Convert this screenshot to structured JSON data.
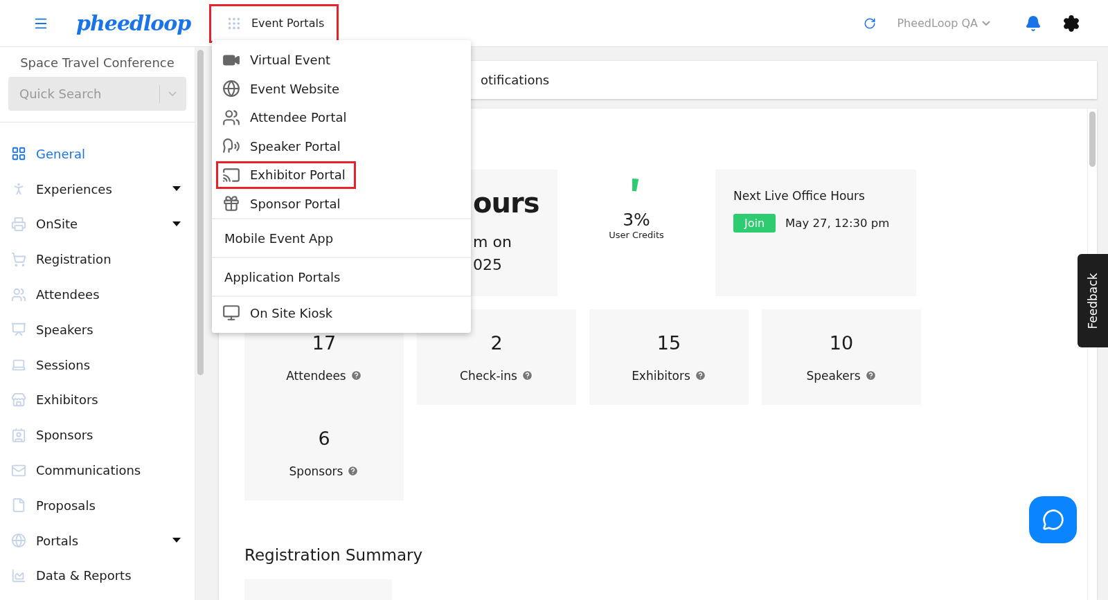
{
  "topbar": {
    "logo": "pheedloop",
    "event_portals": {
      "label": "Event Portals",
      "highlighted": true
    },
    "account": "PheedLoop QA"
  },
  "sidebar": {
    "event_title": "Space Travel Conference",
    "search": {
      "placeholder": "Quick Search"
    },
    "items": [
      {
        "label": "General",
        "selected": true,
        "expandable": false
      },
      {
        "label": "Experiences",
        "selected": false,
        "expandable": true
      },
      {
        "label": "OnSite",
        "selected": false,
        "expandable": true
      },
      {
        "label": "Registration",
        "selected": false,
        "expandable": false
      },
      {
        "label": "Attendees",
        "selected": false,
        "expandable": false
      },
      {
        "label": "Speakers",
        "selected": false,
        "expandable": false
      },
      {
        "label": "Sessions",
        "selected": false,
        "expandable": false
      },
      {
        "label": "Exhibitors",
        "selected": false,
        "expandable": false
      },
      {
        "label": "Sponsors",
        "selected": false,
        "expandable": false
      },
      {
        "label": "Communications",
        "selected": false,
        "expandable": false
      },
      {
        "label": "Proposals",
        "selected": false,
        "expandable": false
      },
      {
        "label": "Portals",
        "selected": false,
        "expandable": true
      },
      {
        "label": "Data & Reports",
        "selected": false,
        "expandable": false
      }
    ]
  },
  "dropdown": {
    "items": [
      {
        "kind": "icon",
        "label": "Virtual Event",
        "highlighted": false
      },
      {
        "kind": "icon",
        "label": "Event Website",
        "highlighted": false
      },
      {
        "kind": "icon",
        "label": "Attendee Portal",
        "highlighted": false
      },
      {
        "kind": "icon",
        "label": "Speaker Portal",
        "highlighted": false
      },
      {
        "kind": "icon",
        "label": "Exhibitor Portal",
        "highlighted": true
      },
      {
        "kind": "icon",
        "label": "Sponsor Portal",
        "highlighted": false
      },
      {
        "kind": "plain",
        "label": "Mobile Event App",
        "highlighted": false
      },
      {
        "kind": "plain",
        "label": "Application Portals",
        "highlighted": false
      },
      {
        "kind": "icon",
        "label": "On Site Kiosk",
        "highlighted": false
      }
    ]
  },
  "tab_fragment": "otifications",
  "hours_card": {
    "big": "ours",
    "line_1": "m on",
    "line_2": "025"
  },
  "credits": {
    "level": 0.03,
    "value": "3%",
    "label": "User Credits"
  },
  "office_hours": {
    "title": "Next Live Office Hours",
    "join": "Join",
    "time": "May 27, 12:30 pm"
  },
  "stats": [
    {
      "value": "17",
      "label": "Attendees"
    },
    {
      "value": "2",
      "label": "Check-ins"
    },
    {
      "value": "15",
      "label": "Exhibitors"
    },
    {
      "value": "10",
      "label": "Speakers"
    },
    {
      "value": "6",
      "label": "Sponsors"
    }
  ],
  "registration_summary": "Registration Summary",
  "feedback": "Feedback"
}
